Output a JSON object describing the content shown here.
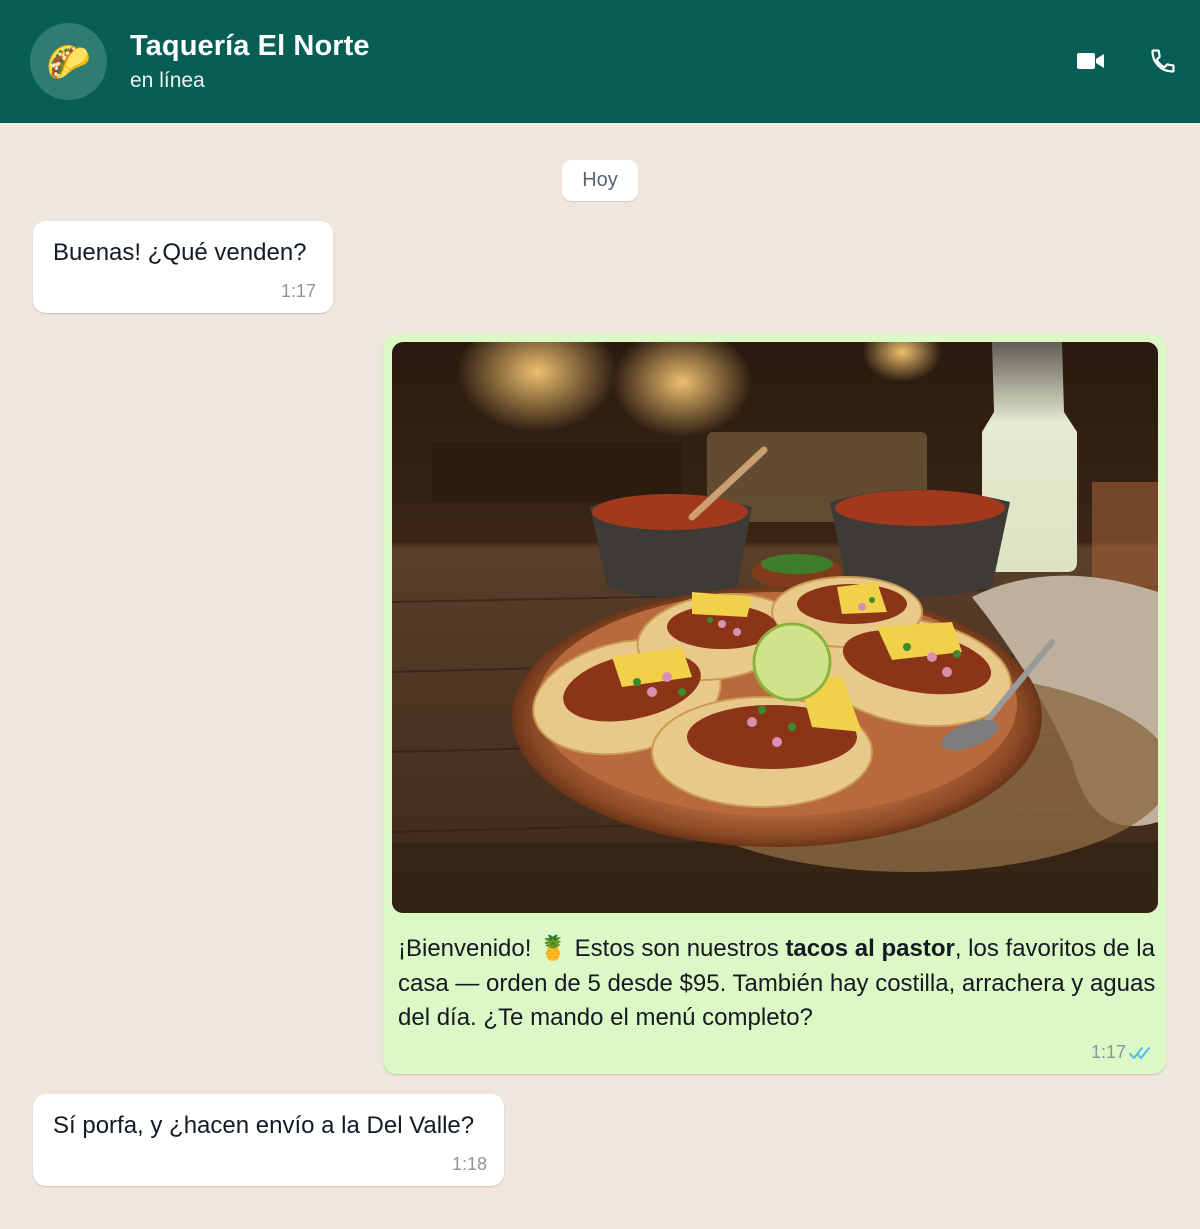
{
  "header": {
    "contact_name": "Taquería El Norte",
    "status": "en línea",
    "avatar_emoji": "🌮",
    "video_icon": "video-camera-icon",
    "call_icon": "phone-icon"
  },
  "colors": {
    "header_bg": "#075e54",
    "chat_bg": "#efe6de",
    "outgoing_bubble": "#dcf8c6",
    "incoming_bubble": "#ffffff",
    "read_ticks": "#53bdeb"
  },
  "chat": {
    "date_divider": "Hoy",
    "messages": [
      {
        "direction": "incoming",
        "text": "Buenas! ¿Qué venden?",
        "time": "1:17"
      },
      {
        "direction": "outgoing",
        "image": "photo of tacos al pastor plate with pineapple, onion and cilantro on rustic wooden table",
        "caption_part1": "¡Bienvenido! ",
        "caption_emoji": "🍍",
        "caption_part2": " Estos son nuestros ",
        "caption_bold": "tacos al pastor",
        "caption_part3": ", los favoritos de la casa — orden de 5 desde $95. También hay costilla, arrachera y aguas del día. ¿Te mando el menú completo?",
        "time": "1:17",
        "status_icon": "double-check-read-icon"
      },
      {
        "direction": "incoming",
        "text": "Sí porfa, y ¿hacen envío a la Del Valle?",
        "time": "1:18"
      }
    ]
  }
}
